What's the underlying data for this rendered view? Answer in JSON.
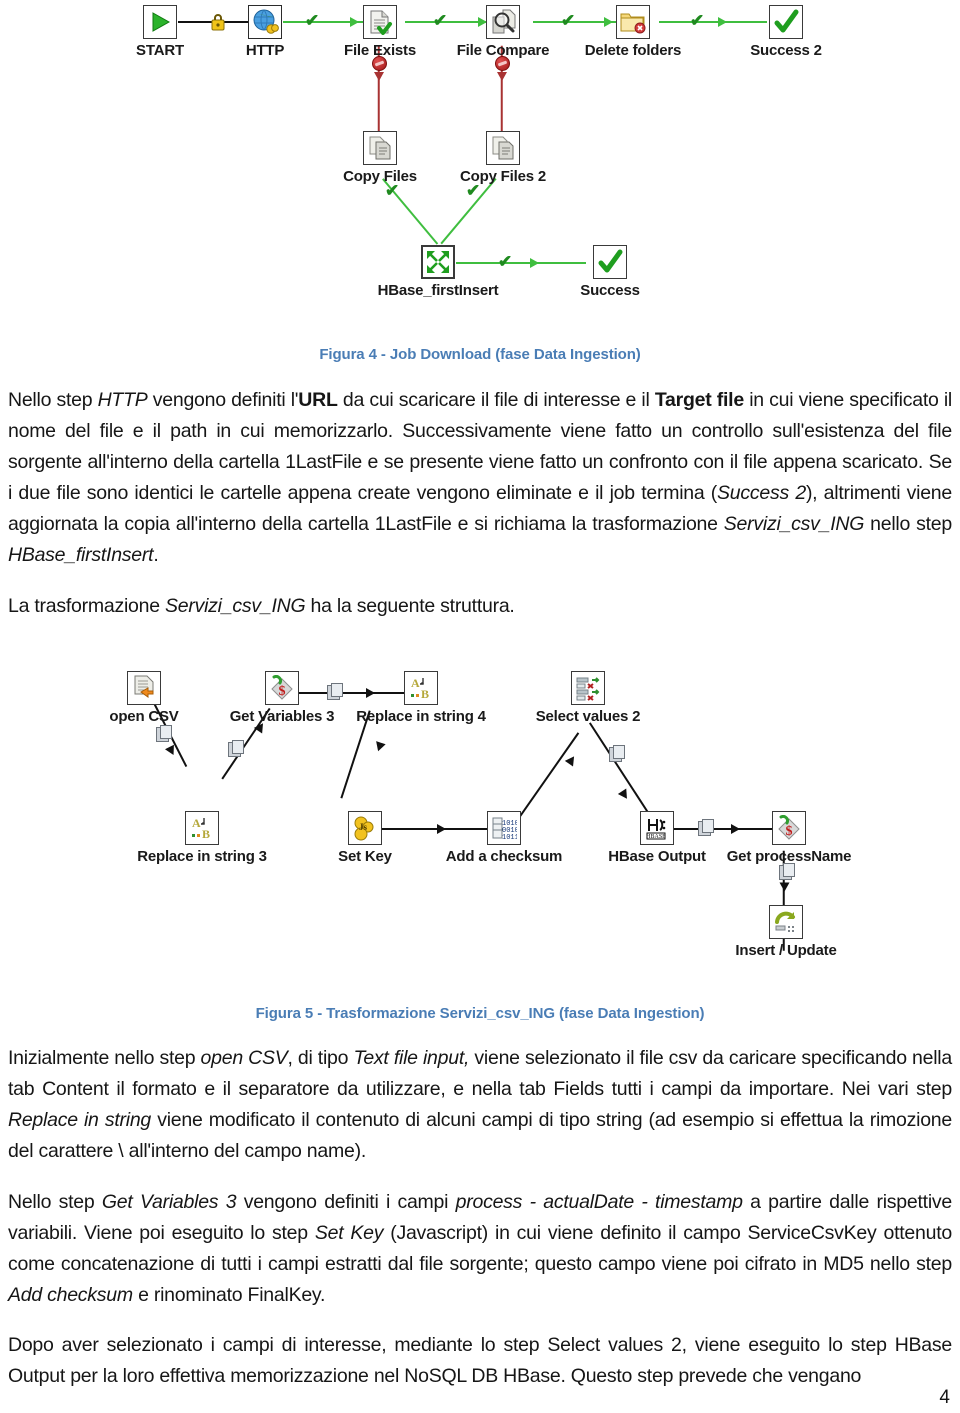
{
  "document": {
    "page_number": "4",
    "caption_color": "#4a7db5"
  },
  "figure4": {
    "caption": "Figura 4 - Job Download (fase Data Ingestion)",
    "nodes": [
      {
        "id": "start",
        "label": "START",
        "icon": "green-play-icon"
      },
      {
        "id": "http",
        "label": "HTTP",
        "icon": "globe-icon"
      },
      {
        "id": "file-exists",
        "label": "File Exists",
        "icon": "document-check-icon"
      },
      {
        "id": "file-compare",
        "label": "File Compare",
        "icon": "magnifier-document-icon"
      },
      {
        "id": "delete-folders",
        "label": "Delete folders",
        "icon": "folder-delete-icon"
      },
      {
        "id": "success2",
        "label": "Success 2",
        "icon": "green-check-icon"
      },
      {
        "id": "copy-files",
        "label": "Copy Files",
        "icon": "copy-documents-icon"
      },
      {
        "id": "copy-files-2",
        "label": "Copy Files 2",
        "icon": "copy-documents-icon"
      },
      {
        "id": "hbase-first",
        "label": "HBase_firstInsert",
        "icon": "converge-arrows-icon"
      },
      {
        "id": "success",
        "label": "Success",
        "icon": "green-check-icon"
      }
    ]
  },
  "figure5": {
    "caption": "Figura 5 - Trasformazione Servizi_csv_ING (fase Data Ingestion)",
    "nodes": [
      {
        "id": "open-csv",
        "label": "open CSV",
        "icon": "text-file-input-icon"
      },
      {
        "id": "get-variables-3",
        "label": "Get Variables 3",
        "icon": "get-variables-icon"
      },
      {
        "id": "replace-4",
        "label": "Replace in string 4",
        "icon": "replace-string-icon"
      },
      {
        "id": "select-values-2",
        "label": "Select values 2",
        "icon": "select-values-icon"
      },
      {
        "id": "replace-3",
        "label": "Replace in string 3",
        "icon": "replace-string-icon"
      },
      {
        "id": "set-key",
        "label": "Set Key",
        "icon": "javascript-icon"
      },
      {
        "id": "add-checksum",
        "label": "Add a checksum",
        "icon": "binary-checksum-icon"
      },
      {
        "id": "hbase-output",
        "label": "HBase Output",
        "icon": "hbase-icon"
      },
      {
        "id": "get-processname",
        "label": "Get processName",
        "icon": "get-variables-icon"
      },
      {
        "id": "insert-update",
        "label": "Insert / Update",
        "icon": "insert-update-icon"
      }
    ]
  },
  "body": {
    "p1_html": "Nello step <i>HTTP</i> vengono definiti l'<b>URL</b> da cui scaricare il file di interesse e il <b>Target file</b> in cui viene specificato il nome del file e il path in cui memorizzarlo. Successivamente viene fatto un controllo sull'esistenza del file sorgente all'interno della cartella 1LastFile e se presente viene fatto un confronto con il file appena scaricato. Se i due file sono identici le cartelle appena create vengono eliminate e il job termina (<i>Success 2</i>), altrimenti viene aggiornata la copia all'interno della cartella 1LastFile e si richiama la trasformazione <i>Servizi_csv_ING</i> nello step <i>HBase_firstInsert</i>.",
    "p2_html": "La trasformazione <i>Servizi_csv_ING</i> ha la seguente struttura.",
    "p3_html": "Inizialmente nello step <i>open CSV</i>, di tipo <i>Text file input,</i> viene selezionato il file csv da caricare specificando nella tab Content il formato e il separatore da utilizzare, e nella tab Fields tutti i campi da importare. Nei vari step <i>Replace in string</i> viene modificato il contenuto di alcuni campi di tipo string (ad esempio si effettua la rimozione del carattere \\ all'interno del campo name).",
    "p4_html": "Nello step <i>Get Variables 3</i> vengono definiti i campi <i>process - actualDate - timestamp</i> a partire dalle rispettive variabili. Viene poi eseguito lo step <i>Set Key</i> (Javascript) in cui viene definito il campo ServiceCsvKey ottenuto come concatenazione di tutti i campi estratti dal file sorgente; questo campo viene poi cifrato in MD5 nello step <i>Add checksum</i> e rinominato FinalKey.",
    "p5_html": "Dopo aver selezionato i campi di interesse, mediante lo step Select values 2, viene eseguito lo step HBase Output per la loro effettiva memorizzazione nel NoSQL DB HBase. Questo step prevede che vengano"
  }
}
